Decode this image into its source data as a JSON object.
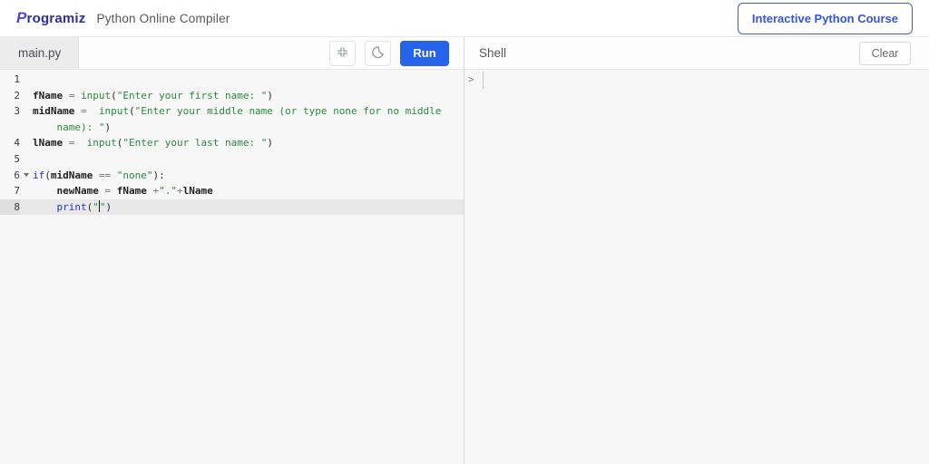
{
  "header": {
    "logo_p": "P",
    "logo_rest": "rogramiz",
    "subtitle": "Python Online Compiler",
    "course_button": "Interactive Python Course"
  },
  "toolbar": {
    "tab": "main.py",
    "run_label": "Run",
    "icons": [
      "collapse-icon",
      "dark-mode-moon-icon"
    ]
  },
  "shell": {
    "title": "Shell",
    "clear_label": "Clear",
    "prompt": ">"
  },
  "colors": {
    "run_button": "#2563eb",
    "course_button": "#3b5fd9",
    "brand": "#2b2da3",
    "keyword": "#2333cf",
    "string": "#2b8a3e",
    "builtin": "#2b8a3e",
    "operator": "#787878",
    "editor_bg": "#f7f7f7",
    "active_line": "#e8e8e8"
  },
  "code": {
    "rows": [
      {
        "num": "1",
        "segments": []
      },
      {
        "num": "2",
        "segments": [
          {
            "t": "fName",
            "c": "v"
          },
          {
            "t": " ",
            "c": "p"
          },
          {
            "t": "=",
            "c": "o"
          },
          {
            "t": " ",
            "c": "p"
          },
          {
            "t": "input",
            "c": "b"
          },
          {
            "t": "(",
            "c": "p"
          },
          {
            "t": "\"Enter your first name: \"",
            "c": "s"
          },
          {
            "t": ")",
            "c": "p"
          }
        ]
      },
      {
        "num": "3",
        "segments": [
          {
            "t": "midName",
            "c": "v"
          },
          {
            "t": " ",
            "c": "p"
          },
          {
            "t": "=",
            "c": "o"
          },
          {
            "t": "  ",
            "c": "p"
          },
          {
            "t": "input",
            "c": "b"
          },
          {
            "t": "(",
            "c": "p"
          },
          {
            "t": "\"Enter your middle name (or type none for no middle",
            "c": "s"
          }
        ]
      },
      {
        "num": "",
        "segments": [
          {
            "t": "    ",
            "c": "p"
          },
          {
            "t": "name): \"",
            "c": "s"
          },
          {
            "t": ")",
            "c": "p"
          }
        ]
      },
      {
        "num": "4",
        "segments": [
          {
            "t": "lName",
            "c": "v"
          },
          {
            "t": " ",
            "c": "p"
          },
          {
            "t": "=",
            "c": "o"
          },
          {
            "t": "  ",
            "c": "p"
          },
          {
            "t": "input",
            "c": "b"
          },
          {
            "t": "(",
            "c": "p"
          },
          {
            "t": "\"Enter your last name: \"",
            "c": "s"
          },
          {
            "t": ")",
            "c": "p"
          }
        ]
      },
      {
        "num": "5",
        "segments": []
      },
      {
        "num": "6",
        "fold": true,
        "segments": [
          {
            "t": "if",
            "c": "k"
          },
          {
            "t": "(",
            "c": "p"
          },
          {
            "t": "midName",
            "c": "v"
          },
          {
            "t": " ",
            "c": "p"
          },
          {
            "t": "==",
            "c": "o"
          },
          {
            "t": " ",
            "c": "p"
          },
          {
            "t": "\"none\"",
            "c": "s"
          },
          {
            "t": "):",
            "c": "p"
          }
        ]
      },
      {
        "num": "7",
        "segments": [
          {
            "t": "    ",
            "c": "p"
          },
          {
            "t": "newName",
            "c": "v"
          },
          {
            "t": " ",
            "c": "p"
          },
          {
            "t": "=",
            "c": "o"
          },
          {
            "t": " ",
            "c": "p"
          },
          {
            "t": "fName",
            "c": "v"
          },
          {
            "t": " ",
            "c": "p"
          },
          {
            "t": "+",
            "c": "o"
          },
          {
            "t": "\".\"",
            "c": "s"
          },
          {
            "t": "+",
            "c": "o"
          },
          {
            "t": "lName",
            "c": "v"
          }
        ]
      },
      {
        "num": "8",
        "active": true,
        "segments": [
          {
            "t": "    ",
            "c": "p"
          },
          {
            "t": "print",
            "c": "k"
          },
          {
            "t": "(",
            "c": "p"
          },
          {
            "t": "\"",
            "c": "s"
          },
          {
            "t": "",
            "c": "cur"
          },
          {
            "t": "\"",
            "c": "s"
          },
          {
            "t": ")",
            "c": "p"
          }
        ]
      }
    ]
  }
}
